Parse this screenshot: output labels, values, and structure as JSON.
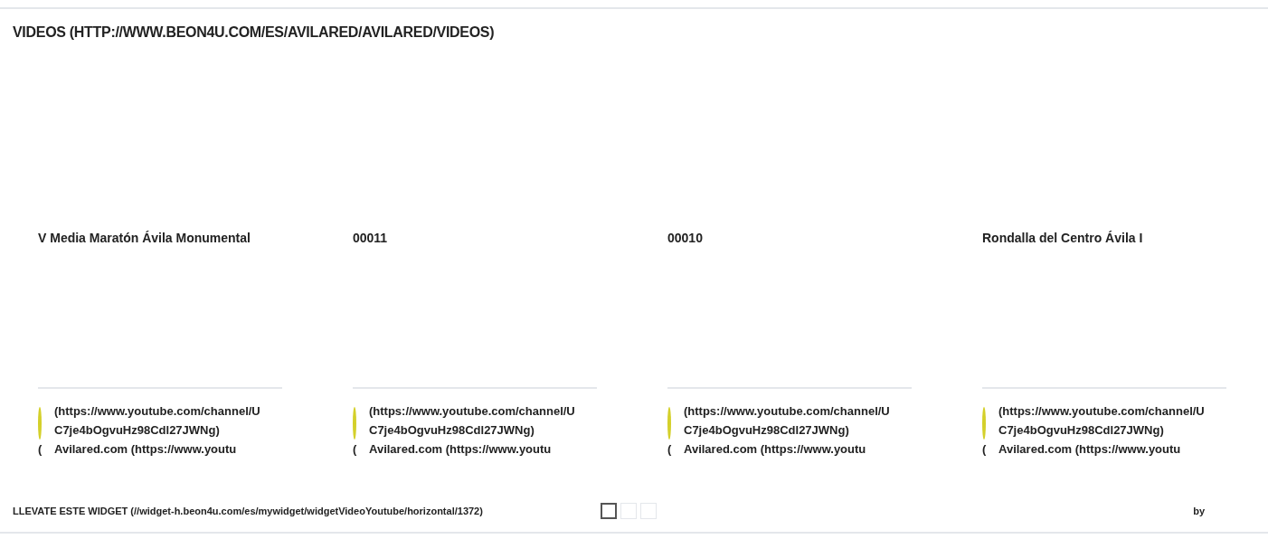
{
  "section_title": "VIDEOS (HTTP://WWW.BEON4U.COM/ES/AVILARED/AVILARED/VIDEOS)",
  "videos": [
    {
      "title": "V Media Maratón Ávila Monumental",
      "channel_url": "(https://www.youtube.com/channel/UC7je4bOgvuHz98Cdl27JWNg)",
      "mark": "(",
      "channel_name": "Avilared.com (https://www.youtu"
    },
    {
      "title": "00011",
      "channel_url": "(https://www.youtube.com/channel/UC7je4bOgvuHz98Cdl27JWNg)",
      "mark": "(",
      "channel_name": "Avilared.com (https://www.youtu"
    },
    {
      "title": "00010",
      "channel_url": "(https://www.youtube.com/channel/UC7je4bOgvuHz98Cdl27JWNg)",
      "mark": "(",
      "channel_name": "Avilared.com (https://www.youtu"
    },
    {
      "title": "Rondalla del Centro Ávila I",
      "channel_url": "(https://www.youtube.com/channel/UC7je4bOgvuHz98Cdl27JWNg)",
      "mark": "(",
      "channel_name": "Avilared.com (https://www.youtu"
    }
  ],
  "footer": {
    "widget_link": "LLEVATE ESTE WIDGET (//widget-h.beon4u.com/es/mywidget/widgetVideoYoutube/horizontal/1372)",
    "pages": [
      {
        "selected": true
      },
      {
        "selected": false
      },
      {
        "selected": false
      }
    ],
    "by": "by"
  }
}
